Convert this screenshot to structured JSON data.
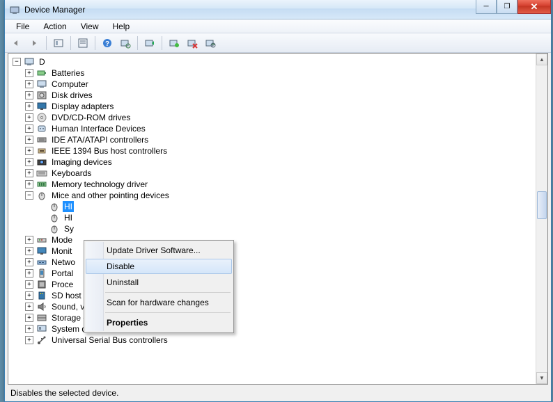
{
  "window": {
    "title": "Device Manager"
  },
  "menubar": [
    "File",
    "Action",
    "View",
    "Help"
  ],
  "tree": {
    "root": "D",
    "categories": [
      {
        "label": "Batteries",
        "icon": "battery"
      },
      {
        "label": "Computer",
        "icon": "computer"
      },
      {
        "label": "Disk drives",
        "icon": "disk"
      },
      {
        "label": "Display adapters",
        "icon": "display"
      },
      {
        "label": "DVD/CD-ROM drives",
        "icon": "dvd"
      },
      {
        "label": "Human Interface Devices",
        "icon": "hid"
      },
      {
        "label": "IDE ATA/ATAPI controllers",
        "icon": "ide"
      },
      {
        "label": "IEEE 1394 Bus host controllers",
        "icon": "ieee"
      },
      {
        "label": "Imaging devices",
        "icon": "imaging"
      },
      {
        "label": "Keyboards",
        "icon": "keyboard"
      },
      {
        "label": "Memory technology driver",
        "icon": "memory"
      },
      {
        "label": "Mice and other pointing devices",
        "icon": "mouse",
        "expanded": true,
        "children": [
          {
            "label": "HI",
            "icon": "mouse",
            "selected": true
          },
          {
            "label": "HI",
            "icon": "mouse"
          },
          {
            "label": "Sy",
            "icon": "mouse"
          }
        ]
      },
      {
        "label": "Mode",
        "icon": "modem"
      },
      {
        "label": "Monit",
        "icon": "monitor"
      },
      {
        "label": "Netwo",
        "icon": "network"
      },
      {
        "label": "Portal",
        "icon": "portable"
      },
      {
        "label": "Proce",
        "icon": "processor"
      },
      {
        "label": "SD host adapters",
        "icon": "sd"
      },
      {
        "label": "Sound, video and game controllers",
        "icon": "sound"
      },
      {
        "label": "Storage controllers",
        "icon": "storage"
      },
      {
        "label": "System devices",
        "icon": "system"
      },
      {
        "label": "Universal Serial Bus controllers",
        "icon": "usb"
      }
    ]
  },
  "context_menu": [
    {
      "label": "Update Driver Software...",
      "type": "item"
    },
    {
      "label": "Disable",
      "type": "item",
      "hovered": true
    },
    {
      "label": "Uninstall",
      "type": "item"
    },
    {
      "type": "sep"
    },
    {
      "label": "Scan for hardware changes",
      "type": "item"
    },
    {
      "type": "sep"
    },
    {
      "label": "Properties",
      "type": "item",
      "bold": true
    }
  ],
  "statusbar": "Disables the selected device."
}
